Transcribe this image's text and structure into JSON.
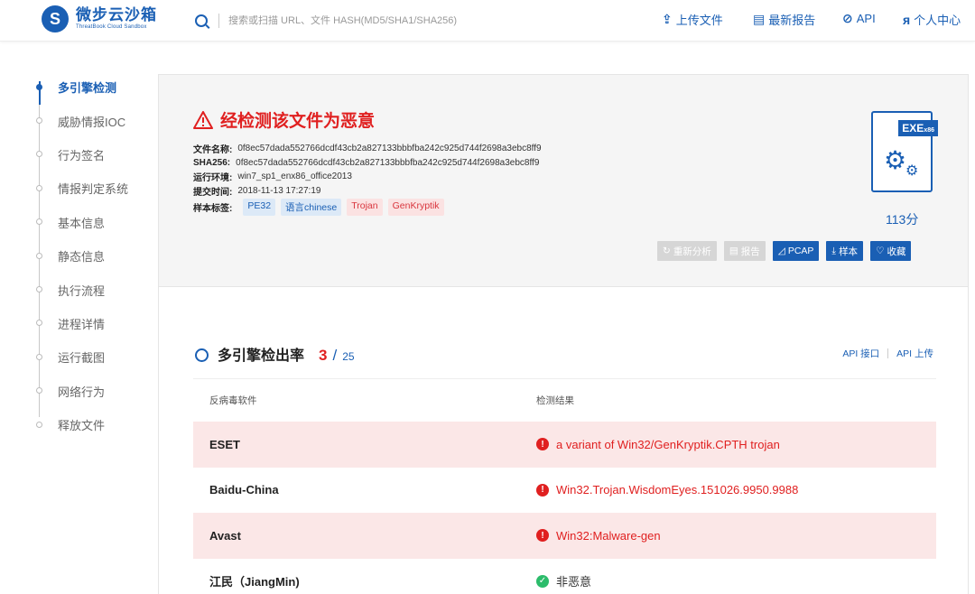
{
  "header": {
    "logo_cn": "微步云沙箱",
    "logo_en": "ThreatBook Cloud Sandbox",
    "search_placeholder": "搜索或扫描 URL、文件 HASH(MD5/SHA1/SHA256)",
    "nav": [
      {
        "label": "上传文件",
        "icon": "upload-icon"
      },
      {
        "label": "最新报告",
        "icon": "report-icon"
      },
      {
        "label": "API",
        "icon": "api-icon"
      },
      {
        "label": "个人中心",
        "icon": "user-icon"
      }
    ]
  },
  "sidebar": {
    "items": [
      {
        "label": "多引擎检测",
        "active": true
      },
      {
        "label": "威胁情报IOC"
      },
      {
        "label": "行为签名"
      },
      {
        "label": "情报判定系统"
      },
      {
        "label": "基本信息"
      },
      {
        "label": "静态信息"
      },
      {
        "label": "执行流程"
      },
      {
        "label": "进程详情"
      },
      {
        "label": "运行截图"
      },
      {
        "label": "网络行为"
      },
      {
        "label": "释放文件"
      }
    ]
  },
  "alert": {
    "title": "经检测该文件为恶意",
    "fields": [
      {
        "key": "文件名称:",
        "value": "0f8ec57dada552766dcdf43cb2a827133bbbfba242c925d744f2698a3ebc8ff9"
      },
      {
        "key": "SHA256:",
        "value": "0f8ec57dada552766dcdf43cb2a827133bbbfba242c925d744f2698a3ebc8ff9"
      },
      {
        "key": "运行环境:",
        "value": "win7_sp1_enx86_office2013"
      },
      {
        "key": "提交时间:",
        "value": "2018-11-13 17:27:19"
      }
    ],
    "tags_label": "样本标签:",
    "tags": [
      {
        "text": "PE32",
        "color": "blue"
      },
      {
        "text": "语言chinese",
        "color": "blue"
      },
      {
        "text": "Trojan",
        "color": "red"
      },
      {
        "text": "GenKryptik",
        "color": "red"
      }
    ],
    "file_type": "EXE",
    "file_arch": "x86",
    "score": "113分",
    "buttons": [
      {
        "label": "重新分析",
        "icon": "refresh-icon",
        "style": "gray"
      },
      {
        "label": "报告",
        "icon": "report-icon",
        "style": "gray"
      },
      {
        "label": "PCAP",
        "icon": "pcap-icon",
        "style": "blue"
      },
      {
        "label": "样本",
        "icon": "download-icon",
        "style": "blue"
      },
      {
        "label": "收藏",
        "icon": "heart-icon",
        "style": "blue"
      }
    ]
  },
  "detection": {
    "title": "多引擎检出率",
    "detected": "3",
    "slash": "/",
    "total": "25",
    "api_links": [
      "API 接口",
      "API 上传"
    ],
    "columns": [
      "反病毒软件",
      "检测结果"
    ],
    "rows": [
      {
        "engine": "ESET",
        "result": "a variant of Win32/GenKryptik.CPTH trojan",
        "malicious": true
      },
      {
        "engine": "Baidu-China",
        "result": "Win32.Trojan.WisdomEyes.151026.9950.9988",
        "malicious": true
      },
      {
        "engine": "Avast",
        "result": "Win32:Malware-gen",
        "malicious": true
      },
      {
        "engine": "江民（JiangMin)",
        "result": "非恶意",
        "malicious": false
      }
    ]
  },
  "colors": {
    "brand": "#1a5fb4",
    "danger": "#e02020",
    "safe": "#2cbc6b",
    "malicious_row": "#fbe7e7"
  }
}
